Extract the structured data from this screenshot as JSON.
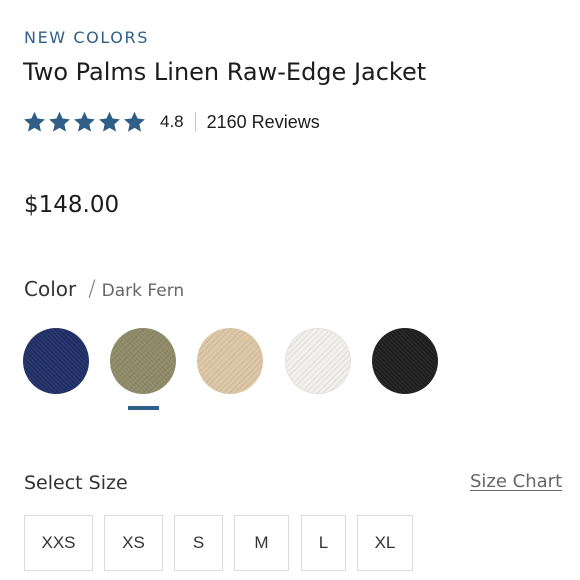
{
  "product": {
    "eyebrow": "NEW COLORS",
    "title": "Two Palms Linen Raw-Edge Jacket",
    "rating": {
      "stars_filled": 5,
      "stars_total": 5,
      "value": "4.8",
      "reviews": "2160 Reviews",
      "star_color": "#2f5f86"
    },
    "price": "$148.00"
  },
  "color": {
    "label": "Color",
    "separator": "/",
    "selected": "Dark Fern",
    "swatches": [
      {
        "name": "navy",
        "color": "#1f2f66"
      },
      {
        "name": "dark-fern",
        "color": "#8e8a68",
        "selected": true
      },
      {
        "name": "sand",
        "color": "#dcc6a5"
      },
      {
        "name": "white",
        "color": "#f1f0ec"
      },
      {
        "name": "black",
        "color": "#1e1e1e"
      }
    ]
  },
  "size": {
    "heading": "Select Size",
    "chart_link": "Size Chart",
    "options": [
      "XXS",
      "XS",
      "S",
      "M",
      "L",
      "XL"
    ]
  }
}
